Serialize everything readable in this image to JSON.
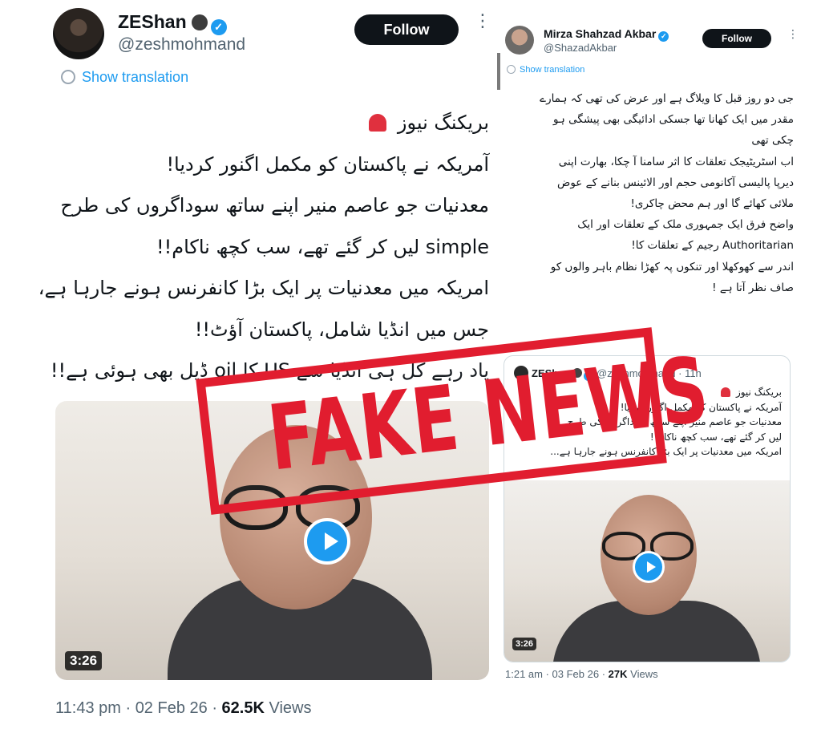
{
  "left_tweet": {
    "display_name": "ZEShan",
    "handle": "@zeshmohmand",
    "follow_label": "Follow",
    "more_label": "⋮",
    "show_translation": "Show translation",
    "body_lines": [
      "بریکنگ نیوز",
      "آمریکہ نے پاکستان کو مکمل اگنور کردیا!",
      "معدنیات جو عاصم منیر اپنے ساتھ سوداگروں کی طرح",
      "simple لیں کر گئے تھے، سب کچھ ناکام!!",
      "امریکہ میں معدنیات پر ایک بڑا کانفرنس ہونے جارہا ہے،",
      "جس میں انڈیا شامل، پاکستان آؤٹ!!",
      "یاد رہے کل ہی انڈیا سے US کا oil ڈیل بھی ہوئی ہے!!"
    ],
    "video_duration": "3:26",
    "time": "11:43 pm",
    "date": "02 Feb 26",
    "views_count": "62.5K",
    "views_label": "Views"
  },
  "right_tweet": {
    "display_name": "Mirza Shahzad Akbar",
    "handle": "@ShazadAkbar",
    "follow_label": "Follow",
    "more_label": "⋮",
    "show_translation": "Show translation",
    "body_lines": [
      "جی دو روز قبل کا ویلاگ ہے اور عرض کی تھی کہ ہمارے",
      "مقدر میں ایک کھانا تھا جسکی ادائیگی بھی پیشگی ہو",
      "چکی تھی",
      "اب اسٹریٹیجک تعلقات کا اثر سامنا آ چکا، بھارت اپنی",
      "دیرپا پالیسی آکانومی حجم اور الائینس بنانے کے عوض",
      "ملائی کھائے گا اور ہم محض چاکری!",
      "واضح فرق ایک جمہوری ملک کے تعلقات اور ایک",
      "Authoritarian رجیم کے تعلقات کا!",
      "اندر سے کھوکھلا اور تنکوں پہ کھڑا نظام باہر والوں کو",
      "صاف نظر آتا ہے !"
    ],
    "quote": {
      "display_name": "ZEShan",
      "handle": "@zeshmohmand",
      "age": "· 11h",
      "body_lines": [
        "بریکنگ نیوز",
        "آمریکہ نے پاکستان کو مکمل اگنور کردیا!",
        "معدنیات جو عاصم منیر اپنے ساتھ سوداگروں کی طرح",
        "لیں کر گئے تھے، سب کچھ ناکام!!",
        "امریکہ میں معدنیات پر ایک بڑا کانفرنس ہونے جارہا ہے..."
      ],
      "video_duration": "3:26"
    },
    "time": "1:21 am",
    "date": "03 Feb 26",
    "views_count": "27K",
    "views_label": "Views"
  },
  "stamp": {
    "text": "FAKE NEWS",
    "color": "#e11d2f"
  },
  "colors": {
    "accent_blue": "#1d9bf0",
    "text_dark": "#0f1419",
    "text_muted": "#536471"
  },
  "icons": {
    "verified": "verified-badge-icon",
    "translate": "translate-icon",
    "play": "play-icon",
    "siren": "siren-emoji-icon",
    "more": "more-options-icon"
  }
}
